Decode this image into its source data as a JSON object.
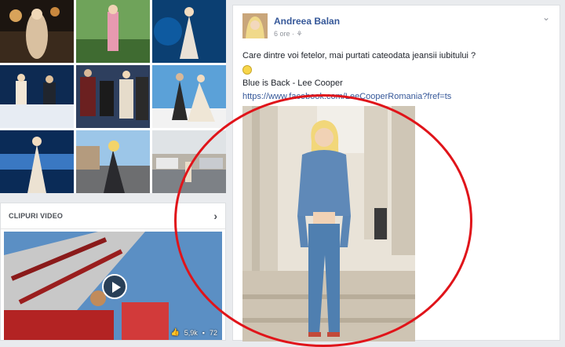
{
  "clips": {
    "title": "CLIPURI VIDEO",
    "likes": "5,9k",
    "comments": "72"
  },
  "post": {
    "author": "Andreea Balan",
    "time": "6 ore",
    "line1": "Care dintre voi fetelor, mai purtati cateodata jeansii iubitului ?",
    "line2": "Blue is Back - Lee Cooper",
    "link": "https://www.facebook.com/LeeCooperRomania?fref=ts"
  },
  "colors": {
    "annotation_circle": "#e0141a",
    "link": "#365899"
  }
}
